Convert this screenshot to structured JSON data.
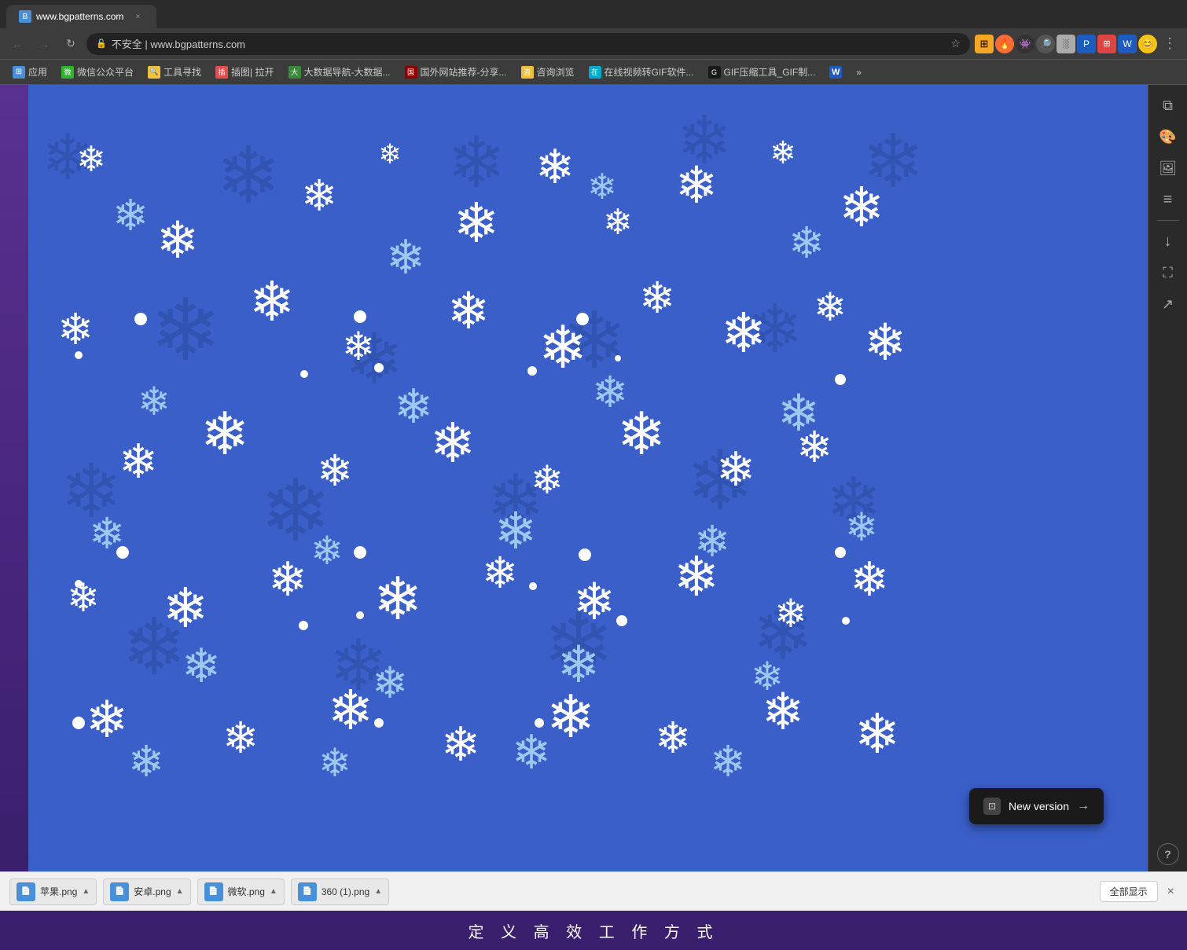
{
  "browser": {
    "tab_title": "www.bgpatterns.com",
    "favicon_text": "B",
    "address": "www.bgpatterns.com",
    "address_protocol": "不安全",
    "nav": {
      "back": "←",
      "forward": "→",
      "refresh": "↻",
      "home": "⌂"
    }
  },
  "bookmarks": [
    {
      "id": "apps",
      "icon": "⊞",
      "label": "应用",
      "color": "#4a90d9"
    },
    {
      "id": "wechat",
      "icon": "●",
      "label": "微信公众平台",
      "color": "#2eb52e"
    },
    {
      "id": "tools",
      "icon": "🔍",
      "label": "工具寻找",
      "color": "#f0c040"
    },
    {
      "id": "plugin",
      "icon": "🖼",
      "label": "插图| 拉开",
      "color": "#e05050"
    },
    {
      "id": "bigdata",
      "icon": "📊",
      "label": "大数据导航-大数据...",
      "color": "#3a8a3a"
    },
    {
      "id": "foreign",
      "icon": "🌐",
      "label": "国外网站推荐-分享...",
      "color": "#8B0000"
    },
    {
      "id": "consult",
      "icon": "📋",
      "label": "咨询浏览",
      "color": "#f0c040"
    },
    {
      "id": "gif",
      "icon": "🎬",
      "label": "在线视频转GIF软件...",
      "color": "#00aacc"
    },
    {
      "id": "gifzip",
      "icon": "👤",
      "label": "GIF压缩工具_GIF制...",
      "color": "#1a1a1a"
    },
    {
      "id": "word",
      "icon": "W",
      "label": "",
      "color": "#1e5bbf"
    }
  ],
  "more_btn": "»",
  "sidebar_icons": [
    {
      "name": "copy",
      "symbol": "⧉"
    },
    {
      "name": "palette",
      "symbol": "🎨"
    },
    {
      "name": "layers-alt",
      "symbol": "🖼"
    },
    {
      "name": "layers",
      "symbol": "⧉"
    },
    {
      "name": "download",
      "symbol": "↓"
    },
    {
      "name": "fullscreen",
      "symbol": "⛶"
    },
    {
      "name": "share",
      "symbol": "↗"
    },
    {
      "name": "help",
      "symbol": "?"
    }
  ],
  "new_version": {
    "label": "New version",
    "arrow": "→",
    "icon": "⊡"
  },
  "downloads": [
    {
      "name": "苹果.png",
      "icon": "📄",
      "color": "#4a90d9"
    },
    {
      "name": "安卓.png",
      "icon": "📄",
      "color": "#4a90d9"
    },
    {
      "name": "微软.png",
      "icon": "📄",
      "color": "#4a90d9"
    },
    {
      "name": "360 (1).png",
      "icon": "📄",
      "color": "#4a90d9"
    }
  ],
  "show_all_label": "全部显示",
  "close_label": "×",
  "taskbar_title": "定 义 高 效 工 作 方 式",
  "pattern_bg": "#3a5fc8"
}
